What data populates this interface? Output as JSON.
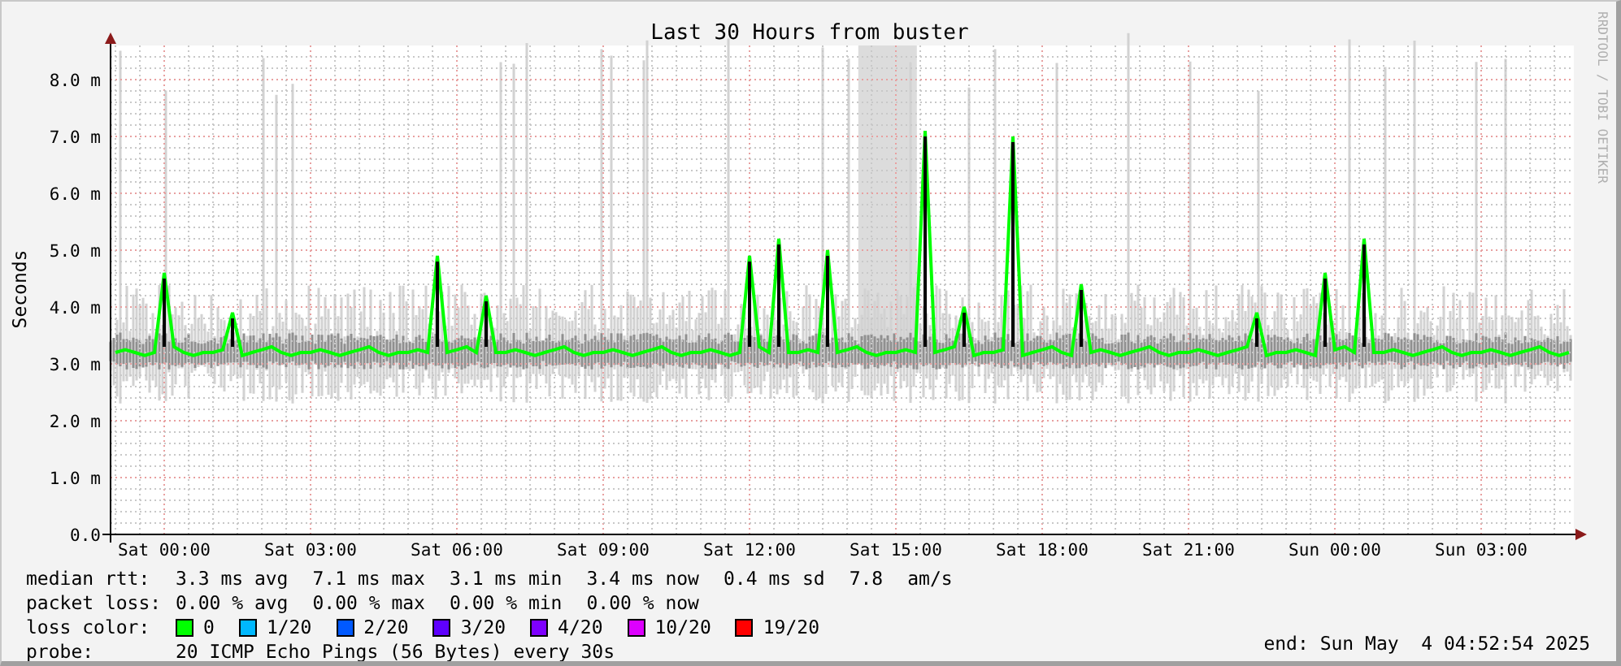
{
  "credit": "RRDTOOL / TOBI OETIKER",
  "chart_data": {
    "type": "line",
    "title": "Last 30 Hours from buster",
    "ylabel": "Seconds",
    "ylim": [
      0,
      8.6
    ],
    "grid": true,
    "categories": [
      null,
      null,
      null,
      null,
      null,
      "Sat 00:00",
      null,
      null,
      null,
      null,
      null,
      null,
      null,
      null,
      null,
      null,
      null,
      null,
      null,
      null,
      "Sat 03:00",
      null,
      null,
      null,
      null,
      null,
      null,
      null,
      null,
      null,
      null,
      null,
      null,
      null,
      null,
      "Sat 06:00",
      null,
      null,
      null,
      null,
      null,
      null,
      null,
      null,
      null,
      null,
      null,
      null,
      null,
      null,
      "Sat 09:00",
      null,
      null,
      null,
      null,
      null,
      null,
      null,
      null,
      null,
      null,
      null,
      null,
      null,
      null,
      "Sat 12:00",
      null,
      null,
      null,
      null,
      null,
      null,
      null,
      null,
      null,
      null,
      null,
      null,
      null,
      null,
      "Sat 15:00",
      null,
      null,
      null,
      null,
      null,
      null,
      null,
      null,
      null,
      null,
      null,
      null,
      null,
      null,
      "Sat 18:00",
      null,
      null,
      null,
      null,
      null,
      null,
      null,
      null,
      null,
      null,
      null,
      null,
      null,
      null,
      "Sat 21:00",
      null,
      null,
      null,
      null,
      null,
      null,
      null,
      null,
      null,
      null,
      null,
      null,
      null,
      null,
      "Sun 00:00",
      null,
      null,
      null,
      null,
      null,
      null,
      null,
      null,
      null,
      null,
      null,
      null,
      null,
      null,
      "Sun 03:00",
      null,
      null,
      null,
      null,
      null,
      null,
      null,
      null,
      null
    ],
    "yticks": [
      {
        "value": 0,
        "label": "0.0"
      },
      {
        "value": 1,
        "label": "1.0 m"
      },
      {
        "value": 2,
        "label": "2.0 m"
      },
      {
        "value": 3,
        "label": "3.0 m"
      },
      {
        "value": 4,
        "label": "4.0 m"
      },
      {
        "value": 5,
        "label": "5.0 m"
      },
      {
        "value": 6,
        "label": "6.0 m"
      },
      {
        "value": 7,
        "label": "7.0 m"
      },
      {
        "value": 8,
        "label": "8.0 m"
      }
    ],
    "series": [
      {
        "color": "#00ff00",
        "values": [
          3.2,
          3.25,
          3.2,
          3.15,
          3.2,
          4.6,
          3.3,
          3.2,
          3.15,
          3.2,
          3.2,
          3.25,
          3.9,
          3.15,
          3.2,
          3.25,
          3.3,
          3.2,
          3.15,
          3.2,
          3.2,
          3.25,
          3.2,
          3.15,
          3.2,
          3.25,
          3.3,
          3.2,
          3.15,
          3.2,
          3.2,
          3.25,
          3.2,
          4.9,
          3.2,
          3.25,
          3.3,
          3.2,
          4.2,
          3.2,
          3.2,
          3.25,
          3.2,
          3.15,
          3.2,
          3.25,
          3.3,
          3.2,
          3.15,
          3.2,
          3.2,
          3.25,
          3.2,
          3.15,
          3.2,
          3.25,
          3.3,
          3.2,
          3.15,
          3.2,
          3.2,
          3.25,
          3.2,
          3.15,
          3.2,
          4.9,
          3.3,
          3.2,
          5.2,
          3.2,
          3.2,
          3.25,
          3.2,
          5.0,
          3.2,
          3.25,
          3.3,
          3.2,
          3.15,
          3.2,
          3.2,
          3.25,
          3.2,
          7.1,
          3.2,
          3.25,
          3.3,
          4.0,
          3.15,
          3.2,
          3.2,
          3.25,
          7.0,
          3.15,
          3.2,
          3.25,
          3.3,
          3.2,
          3.15,
          4.4,
          3.2,
          3.25,
          3.2,
          3.15,
          3.2,
          3.25,
          3.3,
          3.2,
          3.15,
          3.2,
          3.2,
          3.25,
          3.2,
          3.15,
          3.2,
          3.25,
          3.3,
          3.9,
          3.15,
          3.2,
          3.2,
          3.25,
          3.2,
          3.15,
          4.6,
          3.25,
          3.3,
          3.2,
          5.2,
          3.2,
          3.2,
          3.25,
          3.2,
          3.15,
          3.2,
          3.25,
          3.3,
          3.2,
          3.15,
          3.2,
          3.2,
          3.25,
          3.2,
          3.15,
          3.2,
          3.25,
          3.3,
          3.2,
          3.15,
          3.2
        ]
      }
    ]
  },
  "legend": {
    "rows": [
      {
        "label": "median rtt:",
        "items": [
          "3.3 ms avg",
          "7.1 ms max",
          "3.1 ms min",
          "3.4 ms now",
          "0.4 ms sd",
          "7.8",
          "am/s"
        ]
      },
      {
        "label": "packet loss:",
        "items": [
          "0.00 % avg",
          "0.00 % max",
          "0.00 % min",
          "0.00 % now"
        ]
      }
    ],
    "loss_color": {
      "label": "loss color:",
      "items": [
        {
          "label": "0",
          "color": "#00ff00"
        },
        {
          "label": "1/20",
          "color": "#00b8ff"
        },
        {
          "label": "2/20",
          "color": "#0059ff"
        },
        {
          "label": "3/20",
          "color": "#5e00ff"
        },
        {
          "label": "4/20",
          "color": "#7e00ff"
        },
        {
          "label": "10/20",
          "color": "#dd00ff"
        },
        {
          "label": "19/20",
          "color": "#ff0000"
        }
      ]
    },
    "probe": {
      "label": "probe:",
      "text": "20 ICMP Echo Pings (56 Bytes) every 30s"
    },
    "end": "end: Sun May  4 04:52:54 2025"
  }
}
